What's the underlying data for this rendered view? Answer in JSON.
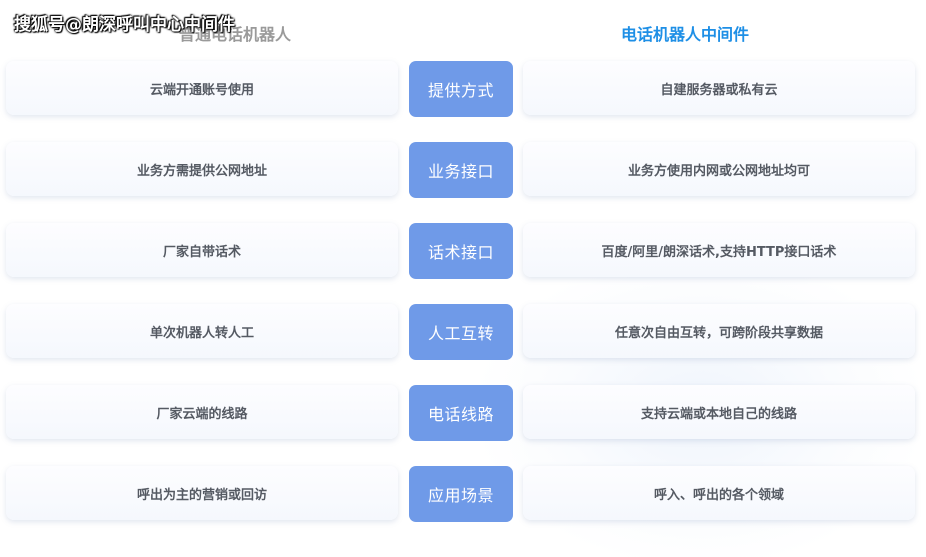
{
  "watermark": "搜狐号@朗深呼叫中心中间件",
  "headers": {
    "left": "普通电话机器人",
    "right": "电话机器人中间件"
  },
  "rows": [
    {
      "left": "云端开通账号使用",
      "center": "提供方式",
      "right": "自建服务器或私有云"
    },
    {
      "left": "业务方需提供公网地址",
      "center": "业务接口",
      "right": "业务方使用内网或公网地址均可"
    },
    {
      "left": "厂家自带话术",
      "center": "话术接口",
      "right": "百度/阿里/朗深话术,支持HTTP接口话术"
    },
    {
      "left": "单次机器人转人工",
      "center": "人工互转",
      "right": "任意次自由互转，可跨阶段共享数据"
    },
    {
      "left": "厂家云端的线路",
      "center": "电话线路",
      "right": "支持云端或本地自己的线路"
    },
    {
      "left": "呼出为主的营销或回访",
      "center": "应用场景",
      "right": "呼入、呼出的各个领域"
    }
  ],
  "colors": {
    "center_bg": "#6f9ae8",
    "right_header": "#1e8fe6",
    "left_header": "#9a9a9a"
  }
}
